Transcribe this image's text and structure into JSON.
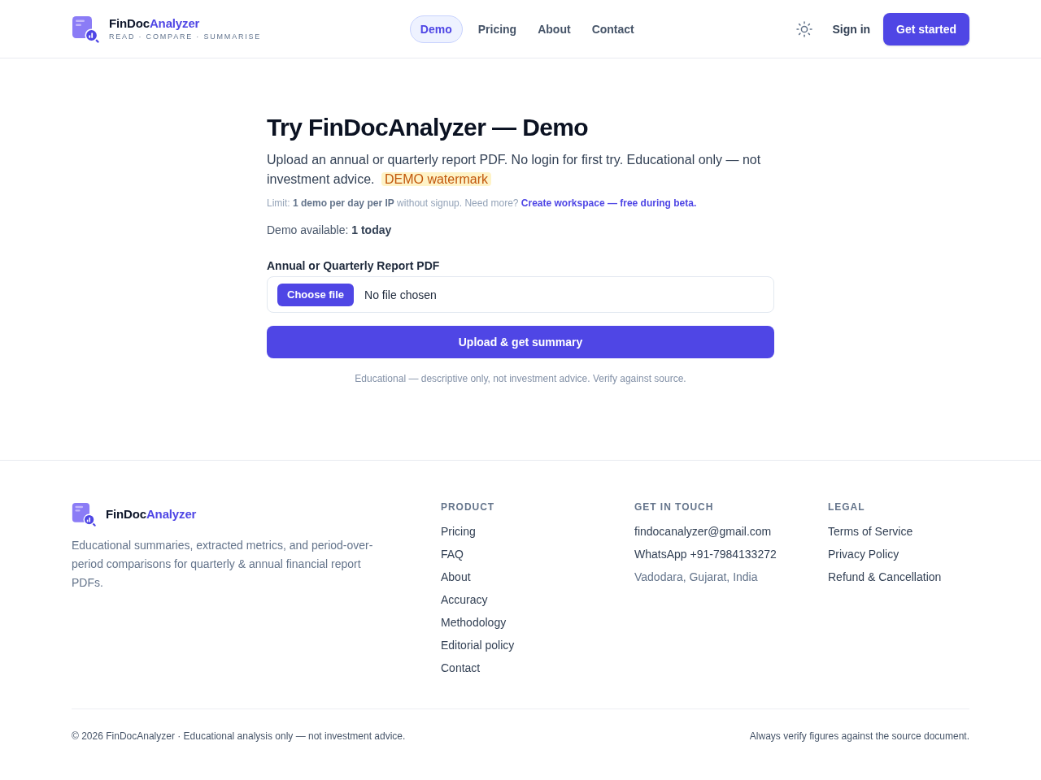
{
  "header": {
    "brand": {
      "name_prefix": "FinDoc",
      "name_suffix": "Analyzer",
      "tagline": "READ · COMPARE · SUMMARISE"
    },
    "nav": [
      {
        "label": "Demo",
        "selected": true
      },
      {
        "label": "Pricing",
        "selected": false
      },
      {
        "label": "About",
        "selected": false
      },
      {
        "label": "Contact",
        "selected": false
      }
    ],
    "sign_in": "Sign in",
    "get_started": "Get started"
  },
  "demo": {
    "title": "Try FinDocAnalyzer — Demo",
    "intro": "Upload an annual or quarterly report PDF. No login for first try. Educational only — not investment advice.",
    "badge": "DEMO watermark",
    "limit": "Limit: **1 demo per day per IP** without signup. Need more?",
    "limit_link": "Create workspace — free during beta.",
    "availability": "Demo available: **1 today**",
    "file_field": {
      "label": "Annual or Quarterly Report PDF",
      "button": "Choose file",
      "status": "No file chosen"
    },
    "submit": "Upload & get summary",
    "note": "Educational — descriptive only, not investment advice. Verify against source."
  },
  "footer": {
    "brand": {
      "name_prefix": "FinDoc",
      "name_suffix": "Analyzer"
    },
    "description": "Educational summaries, extracted metrics, and period-over-period comparisons for quarterly & annual financial report PDFs.",
    "columns": [
      {
        "heading": "PRODUCT",
        "items": [
          {
            "label": "Pricing",
            "kind": "link"
          },
          {
            "label": "FAQ",
            "kind": "link"
          },
          {
            "label": "About",
            "kind": "link"
          },
          {
            "label": "Accuracy",
            "kind": "link"
          },
          {
            "label": "Methodology",
            "kind": "link"
          },
          {
            "label": "Editorial policy",
            "kind": "link"
          },
          {
            "label": "Contact",
            "kind": "link"
          }
        ]
      },
      {
        "heading": "GET IN TOUCH",
        "items": [
          {
            "label": "findocanalyzer@gmail.com",
            "kind": "link"
          },
          {
            "label": "WhatsApp +91-7984133272",
            "kind": "link"
          },
          {
            "label": "Vadodara, Gujarat, India",
            "kind": "text"
          }
        ]
      },
      {
        "heading": "LEGAL",
        "items": [
          {
            "label": "Terms of Service",
            "kind": "link"
          },
          {
            "label": "Privacy Policy",
            "kind": "link"
          },
          {
            "label": "Refund & Cancellation",
            "kind": "link"
          }
        ]
      }
    ],
    "copyright": "© 2026 FinDocAnalyzer · Educational analysis only — not investment advice.",
    "verify_note": "Always verify figures against the source document."
  }
}
